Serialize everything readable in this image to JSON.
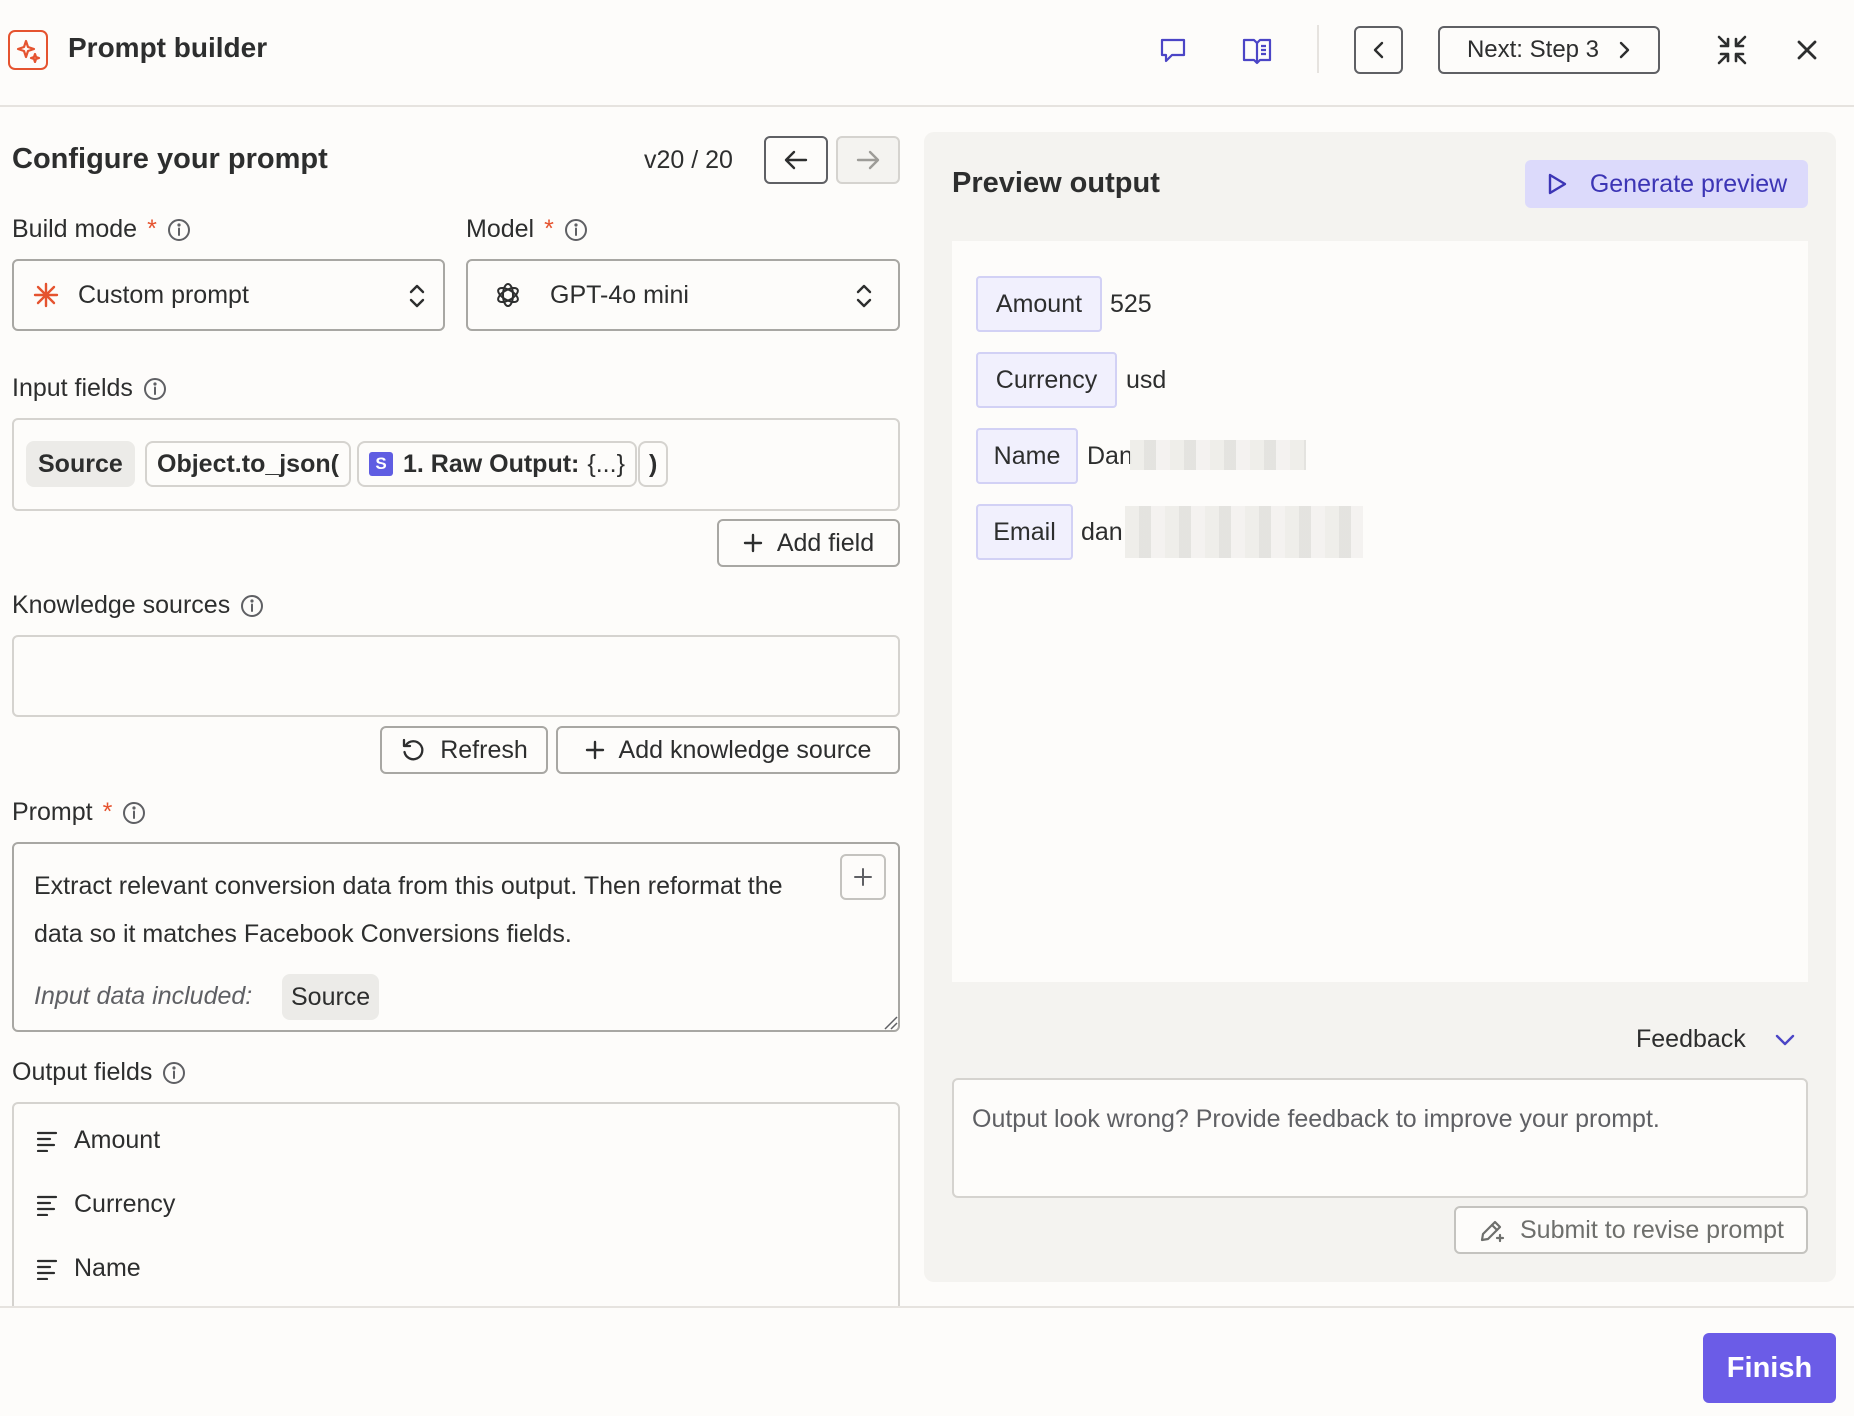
{
  "header": {
    "title": "Prompt builder",
    "next_label": "Next: Step 3"
  },
  "configure": {
    "title": "Configure your prompt",
    "version": "v20 / 20"
  },
  "build_mode": {
    "label": "Build mode",
    "required_mark": "*",
    "value": "Custom prompt"
  },
  "model": {
    "label": "Model",
    "required_mark": "*",
    "value": "GPT-4o mini"
  },
  "input_fields": {
    "label": "Input fields",
    "source_pill": "Source",
    "func_pill": "Object.to_json(",
    "badge": "S",
    "raw_output_label": "1. Raw Output:",
    "raw_output_value": "{...}",
    "close_paren": ")",
    "add_field": "Add field"
  },
  "knowledge": {
    "label": "Knowledge sources",
    "refresh": "Refresh",
    "add_source": "Add knowledge source"
  },
  "prompt": {
    "label": "Prompt",
    "required_mark": "*",
    "text_line1": "Extract relevant conversion data from this output. Then reformat the",
    "text_line2": "data so it matches Facebook Conversions fields.",
    "included_label": "Input data included:",
    "included_pill": "Source"
  },
  "output_fields": {
    "label": "Output fields",
    "items": [
      "Amount",
      "Currency",
      "Name"
    ]
  },
  "preview": {
    "title": "Preview output",
    "generate": "Generate preview",
    "rows": [
      {
        "key": "Amount",
        "value": "525"
      },
      {
        "key": "Currency",
        "value": "usd"
      },
      {
        "key": "Name",
        "value": "Dan"
      },
      {
        "key": "Email",
        "value": "dan"
      }
    ]
  },
  "feedback": {
    "label": "Feedback",
    "placeholder": "Output look wrong? Provide feedback to improve your prompt.",
    "submit": "Submit to revise prompt"
  },
  "footer": {
    "finish": "Finish"
  },
  "colors": {
    "accent": "#6b5ce7",
    "brand_orange": "#e5532f",
    "link_purple": "#4b45c6"
  }
}
